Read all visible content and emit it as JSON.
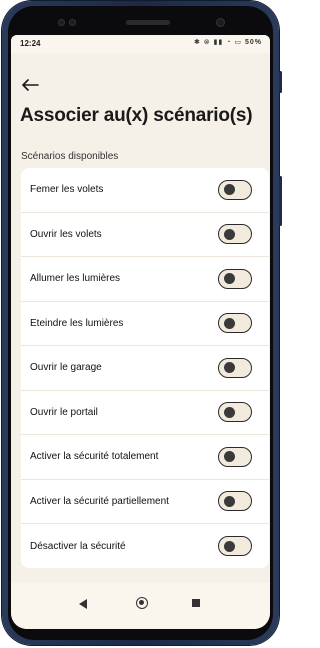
{
  "status_bar": {
    "time": "12:24",
    "icons": "✱ ⊗ ▮▮ ◔ ▭",
    "battery": "50%"
  },
  "header": {
    "back_icon": "arrow-left-icon",
    "title": "Associer au(x) scénario(s)"
  },
  "section_label": "Scénarios disponibles",
  "scenarios": [
    {
      "label": "Femer les volets",
      "enabled": false
    },
    {
      "label": "Ouvrir les volets",
      "enabled": false
    },
    {
      "label": "Allumer les lumières",
      "enabled": false
    },
    {
      "label": "Eteindre les lumières",
      "enabled": false
    },
    {
      "label": "Ouvrir le garage",
      "enabled": false
    },
    {
      "label": "Ouvrir le portail",
      "enabled": false
    },
    {
      "label": "Activer la sécurité totalement",
      "enabled": false
    },
    {
      "label": "Activer la sécurité partiellement",
      "enabled": false
    },
    {
      "label": "Désactiver la sécurité",
      "enabled": false
    }
  ],
  "nav_bar": {
    "back": "triangle-back-icon",
    "home": "circle-home-icon",
    "recent": "square-recent-icon"
  },
  "colors": {
    "background": "#f5f0e8",
    "card": "#ffffff",
    "toggle_track": "#f2eadc",
    "toggle_knob": "#3a3a3a",
    "phone_frame": "#1c2a48"
  }
}
